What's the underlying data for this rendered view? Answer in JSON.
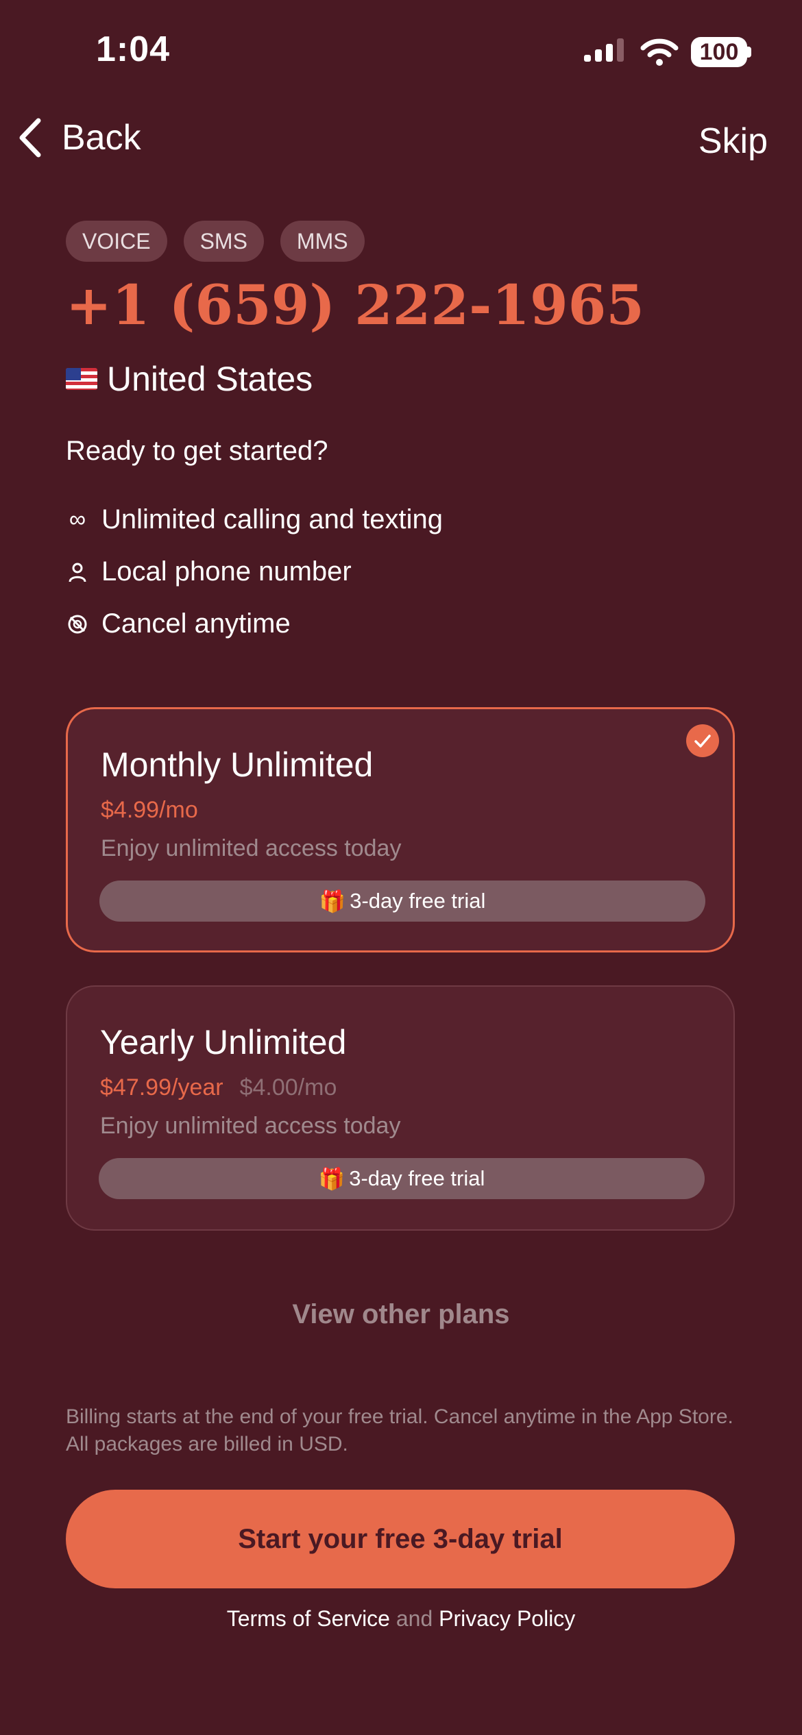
{
  "status_bar": {
    "time": "1:04",
    "battery": "100"
  },
  "nav": {
    "back_label": "Back",
    "skip_label": "Skip"
  },
  "tags": [
    "VOICE",
    "SMS",
    "MMS"
  ],
  "phone_number": "+1 (659) 222-1965",
  "country": {
    "flag": "🇺🇸",
    "name": "United States"
  },
  "prompt": "Ready to get started?",
  "features": [
    {
      "icon": "infinity-icon",
      "label": "Unlimited calling and texting"
    },
    {
      "icon": "person-icon",
      "label": "Local phone number"
    },
    {
      "icon": "cancel-icon",
      "label": "Cancel anytime"
    }
  ],
  "plans": [
    {
      "title": "Monthly Unlimited",
      "price": "$4.99/mo",
      "alt_price": "",
      "description": "Enjoy unlimited access today",
      "trial": "3-day free trial",
      "selected": true
    },
    {
      "title": "Yearly Unlimited",
      "price": "$47.99/year",
      "alt_price": "$4.00/mo",
      "description": "Enjoy unlimited access today",
      "trial": "3-day free trial",
      "selected": false
    }
  ],
  "view_other_plans": "View other plans",
  "billing_note": "Billing starts at the end of your free trial. Cancel anytime in the App Store. All packages are billed in USD.",
  "cta_label": "Start your free 3-day trial",
  "legal": {
    "terms": "Terms of Service",
    "and": "and",
    "privacy": "Privacy Policy"
  },
  "colors": {
    "background": "#4a1923",
    "accent": "#e8694a",
    "card": "#57222d"
  }
}
